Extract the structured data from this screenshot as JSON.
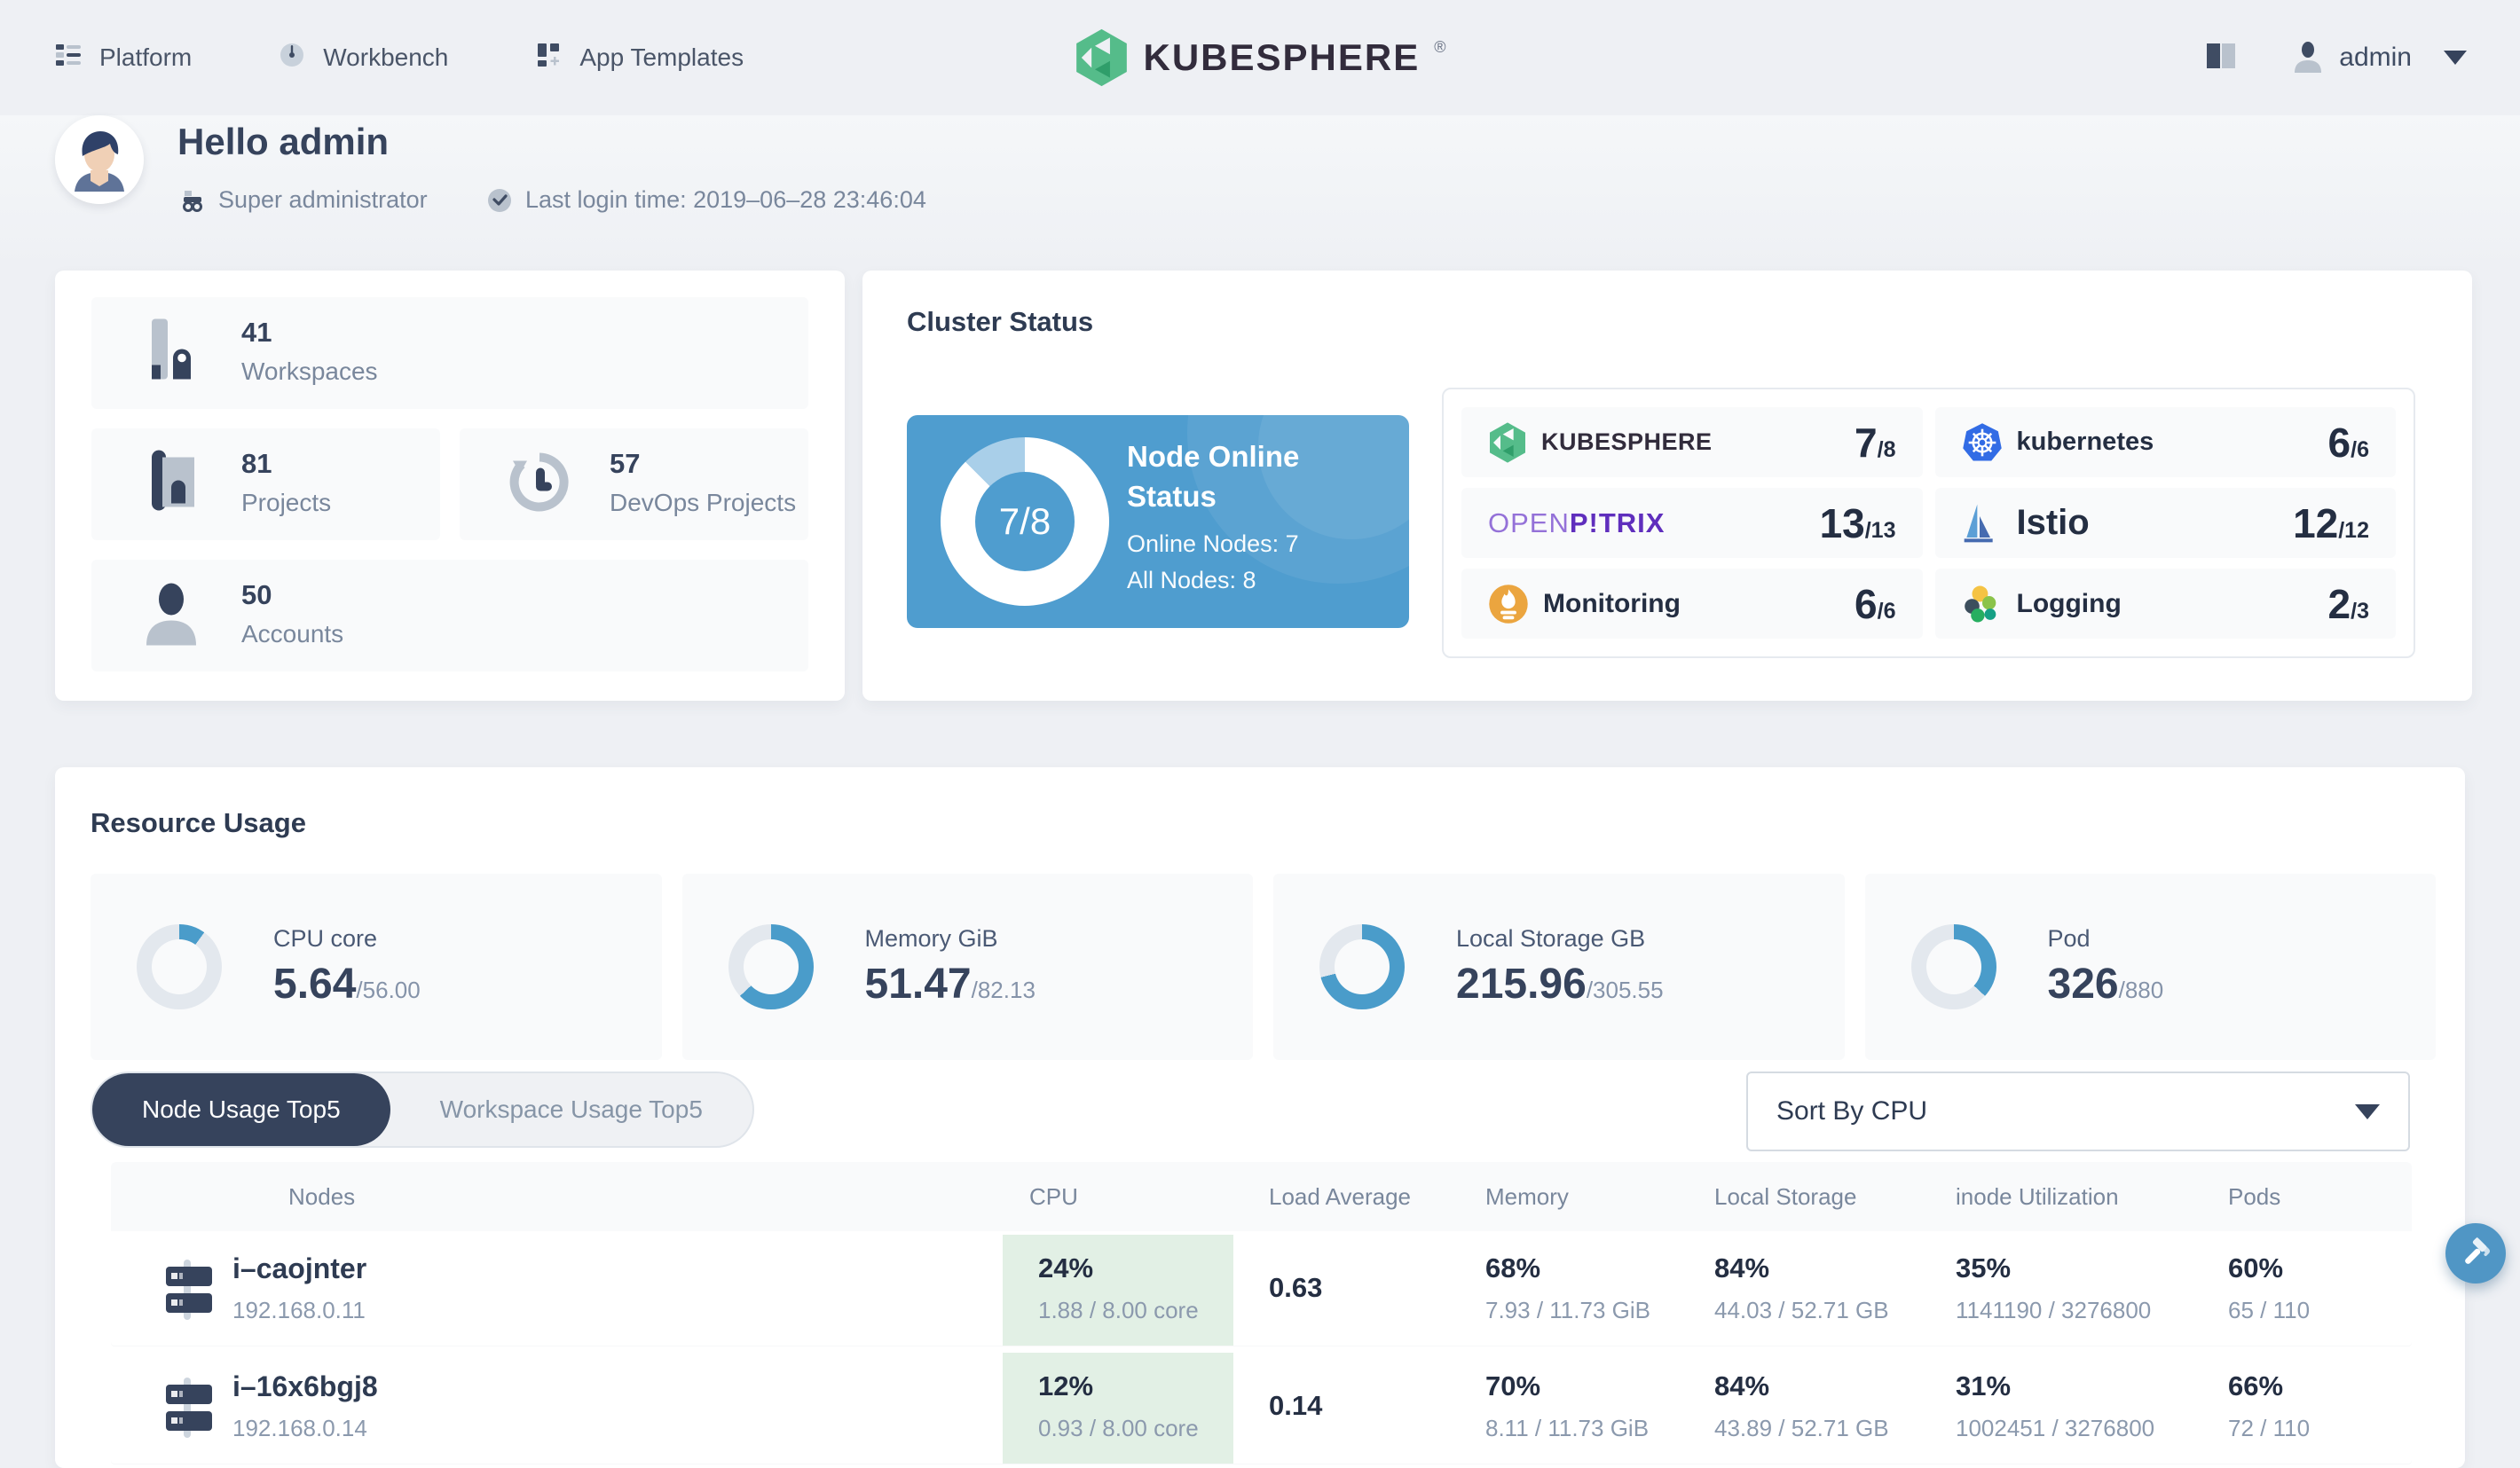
{
  "colors": {
    "accent_blue": "#4a9cca",
    "node_card_blue": "#4f9dcf",
    "dark": "#36435c",
    "gray_text": "#79879c",
    "tile_bg": "#f9fafb",
    "cpu_green_bg": "#e2f0e5",
    "track": "#e3e8ee",
    "logo_green": "#55bc8a"
  },
  "nav": {
    "items": [
      {
        "label": "Platform"
      },
      {
        "label": "Workbench"
      },
      {
        "label": "App Templates"
      }
    ],
    "logo_text": "KUBESPHERE",
    "logo_reg": "®",
    "user": "admin"
  },
  "banner": {
    "greeting": "Hello admin",
    "role": "Super administrator",
    "last_login": "Last login time: 2019–06–28 23:46:04"
  },
  "stats": [
    {
      "value": "41",
      "label": "Workspaces"
    },
    {
      "value": "81",
      "label": "Projects"
    },
    {
      "value": "57",
      "label": "DevOps Projects"
    },
    {
      "value": "50",
      "label": "Accounts"
    }
  ],
  "cluster": {
    "title": "Cluster Status",
    "node_online": {
      "ratio": "7/8",
      "title": "Node Online Status",
      "online_line": "Online Nodes: 7",
      "all_line": "All Nodes: 8"
    },
    "components": [
      {
        "name": "KUBESPHERE",
        "count": "7",
        "total": "/8"
      },
      {
        "name": "kubernetes",
        "count": "6",
        "total": "/6"
      },
      {
        "name_open": "OPEN",
        "name_pitrix": "P!TRIX",
        "count": "13",
        "total": "/13"
      },
      {
        "name": "Istio",
        "count": "12",
        "total": "/12"
      },
      {
        "name": "Monitoring",
        "count": "6",
        "total": "/6"
      },
      {
        "name": "Logging",
        "count": "2",
        "total": "/3"
      }
    ]
  },
  "resource": {
    "title": "Resource Usage",
    "gauges": [
      {
        "label": "CPU core",
        "used": "5.64",
        "total": "/56.00",
        "pct": 10
      },
      {
        "label": "Memory GiB",
        "used": "51.47",
        "total": "/82.13",
        "pct": 63
      },
      {
        "label": "Local Storage GB",
        "used": "215.96",
        "total": "/305.55",
        "pct": 71
      },
      {
        "label": "Pod",
        "used": "326",
        "total": "/880",
        "pct": 37
      }
    ],
    "tabs": [
      {
        "label": "Node Usage Top5"
      },
      {
        "label": "Workspace Usage Top5"
      }
    ],
    "sort": {
      "value": "Sort By CPU"
    },
    "table": {
      "columns": [
        "Nodes",
        "CPU",
        "Load Average",
        "Memory",
        "Local Storage",
        "inode Utilization",
        "Pods"
      ],
      "rows": [
        {
          "name": "i–caojnter",
          "ip": "192.168.0.11",
          "cpu_pct": "24%",
          "cpu_det": "1.88 / 8.00 core",
          "load": "0.63",
          "mem_pct": "68%",
          "mem_det": "7.93 / 11.73 GiB",
          "sto_pct": "84%",
          "sto_det": "44.03 / 52.71 GB",
          "inode_pct": "35%",
          "inode_det": "1141190 / 3276800",
          "pods_pct": "60%",
          "pods_det": "65 / 110"
        },
        {
          "name": "i–16x6bgj8",
          "ip": "192.168.0.14",
          "cpu_pct": "12%",
          "cpu_det": "0.93 / 8.00 core",
          "load": "0.14",
          "mem_pct": "70%",
          "mem_det": "8.11 / 11.73 GiB",
          "sto_pct": "84%",
          "sto_det": "43.89 / 52.71 GB",
          "inode_pct": "31%",
          "inode_det": "1002451 / 3276800",
          "pods_pct": "66%",
          "pods_det": "72 / 110"
        }
      ]
    }
  }
}
